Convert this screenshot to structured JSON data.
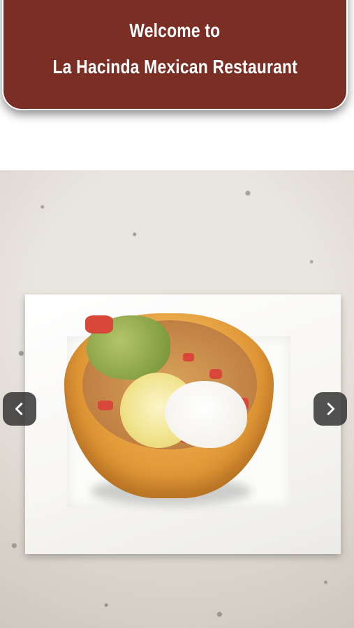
{
  "header": {
    "line1": "Welcome to",
    "line2": "La Hacinda Mexican Restaurant",
    "background_color": "#7a2e24",
    "text_color": "#ffffff"
  },
  "carousel": {
    "image_description_icon": "taco-salad-photo",
    "prev_icon": "chevron-left-icon",
    "next_icon": "chevron-right-icon"
  }
}
